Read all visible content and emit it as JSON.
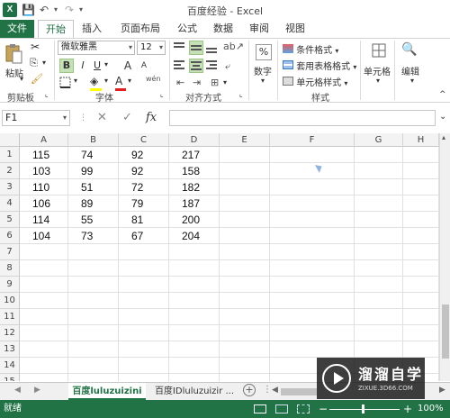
{
  "titlebar": {
    "app_icon": "X",
    "title": "百度经验 - Excel",
    "icons": [
      "save-icon",
      "undo-icon",
      "redo-icon"
    ]
  },
  "ribbon_tabs": [
    "文件",
    "开始",
    "插入",
    "页面布局",
    "公式",
    "数据",
    "审阅",
    "视图"
  ],
  "ribbon": {
    "clipboard": {
      "paste": "粘贴",
      "label": "剪贴板"
    },
    "font": {
      "name": "微软雅黑",
      "size": "12",
      "bold": "B",
      "italic": "I",
      "underline": "U",
      "grow": "A",
      "shrink": "A",
      "font_color": "A",
      "wen": "wén",
      "label": "字体"
    },
    "alignment": {
      "label": "对齐方式"
    },
    "number": {
      "percent": "%",
      "label": "数字"
    },
    "styles": {
      "conditional": "条件格式",
      "table": "套用表格格式",
      "cell_styles": "单元格样式",
      "label": "样式"
    },
    "cells": {
      "label": "单元格"
    },
    "editing": {
      "label": "编辑"
    }
  },
  "formula_bar": {
    "name_box": "F1",
    "cancel": "✕",
    "enter": "✓",
    "fx": "fx",
    "value": ""
  },
  "columns": [
    "A",
    "B",
    "C",
    "D",
    "E",
    "F",
    "G",
    "H"
  ],
  "rows": [
    "1",
    "2",
    "3",
    "4",
    "5",
    "6",
    "7",
    "8",
    "9",
    "10",
    "11",
    "12",
    "13",
    "14",
    "15"
  ],
  "cells": [
    [
      "115",
      "74",
      "92",
      "217"
    ],
    [
      "103",
      "99",
      "92",
      "158"
    ],
    [
      "110",
      "51",
      "72",
      "182"
    ],
    [
      "106",
      "89",
      "79",
      "187"
    ],
    [
      "114",
      "55",
      "81",
      "200"
    ],
    [
      "104",
      "73",
      "67",
      "204"
    ]
  ],
  "sheet_tabs": [
    "百度luluzuizini",
    "百度IDluluzuizir ..."
  ],
  "status": {
    "ready": "就绪",
    "zoom": "100%",
    "zoom_minus": "−",
    "zoom_plus": "+"
  },
  "watermark": {
    "name": "溜溜自学",
    "url": "ZIXUE.3D66.COM"
  },
  "colors": {
    "excel_green": "#217346",
    "selected_button": "#c5e0b4"
  }
}
